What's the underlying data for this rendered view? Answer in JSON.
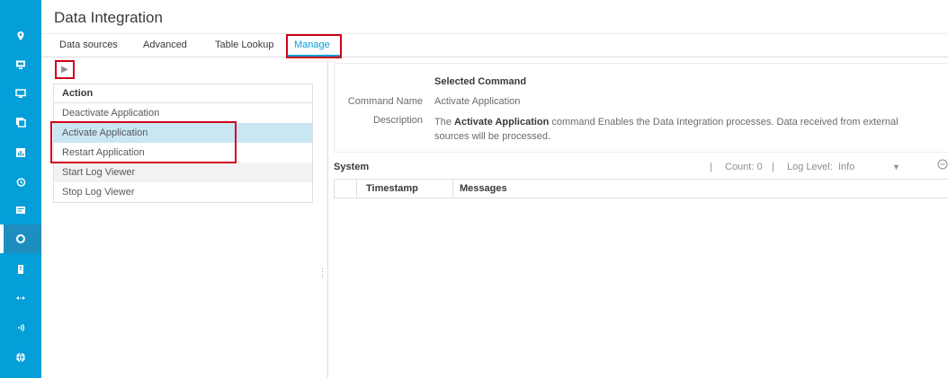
{
  "app": {
    "title": "Data Integration",
    "accent_color": "#049fd9",
    "rail_icons": [
      "location-icon",
      "monitor-icon",
      "display-icon",
      "copy-icon",
      "chart-icon",
      "history-icon",
      "list-icon",
      "circle-icon",
      "server-icon",
      "arrows-icon",
      "wireless-icon",
      "globe-icon"
    ],
    "rail_active_index": 7
  },
  "tabs": [
    {
      "label": "Data sources",
      "active": false
    },
    {
      "label": "Advanced",
      "active": false
    },
    {
      "label": "Table Lookup",
      "active": false
    },
    {
      "label": "Manage",
      "active": true
    }
  ],
  "actions": {
    "header": "Action",
    "items": [
      {
        "label": "Deactivate Application",
        "state": "normal"
      },
      {
        "label": "Activate Application",
        "state": "selected"
      },
      {
        "label": "Restart Application",
        "state": "normal"
      },
      {
        "label": "Start Log Viewer",
        "state": "hover"
      },
      {
        "label": "Stop Log Viewer",
        "state": "normal"
      }
    ]
  },
  "selected_command": {
    "title": "Selected Command",
    "name_label": "Command Name",
    "name_value": "Activate Application",
    "description_label": "Description",
    "description_prefix": "The ",
    "description_bold": "Activate Application",
    "description_suffix": " command Enables the Data Integration processes. Data received from external sources will be processed."
  },
  "system": {
    "title": "System",
    "separator": "|",
    "count_text": "Count: 0",
    "log_level_label": "Log Level:",
    "log_level_value": "Info",
    "columns": [
      "Timestamp",
      "Messages"
    ]
  }
}
